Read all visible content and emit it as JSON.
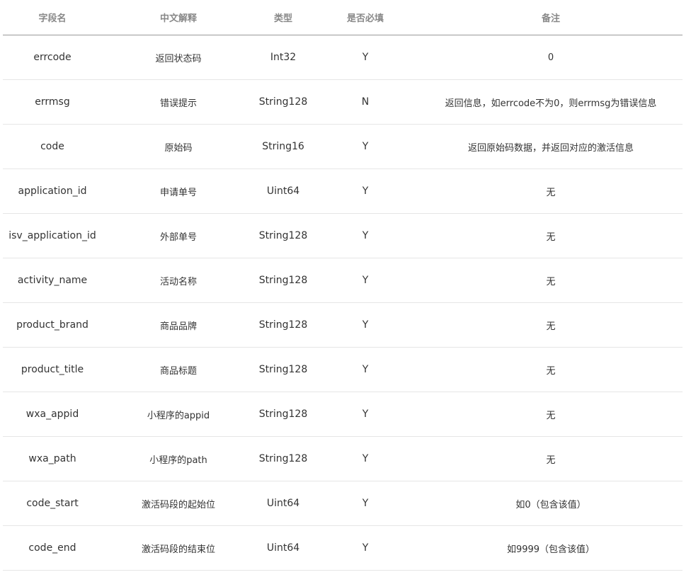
{
  "table": {
    "headers": [
      "字段名",
      "中文解释",
      "类型",
      "是否必填",
      "备注"
    ],
    "rows": [
      [
        "errcode",
        "返回状态码",
        "Int32",
        "Y",
        "0"
      ],
      [
        "errmsg",
        "错误提示",
        "String128",
        "N",
        "返回信息，如errcode不为0，则errmsg为错误信息"
      ],
      [
        "code",
        "原始码",
        "String16",
        "Y",
        "返回原始码数据，并返回对应的激活信息"
      ],
      [
        "application_id",
        "申请单号",
        "Uint64",
        "Y",
        "无"
      ],
      [
        "isv_application_id",
        "外部单号",
        "String128",
        "Y",
        "无"
      ],
      [
        "activity_name",
        "活动名称",
        "String128",
        "Y",
        "无"
      ],
      [
        "product_brand",
        "商品品牌",
        "String128",
        "Y",
        "无"
      ],
      [
        "product_title",
        "商品标题",
        "String128",
        "Y",
        "无"
      ],
      [
        "wxa_appid",
        "小程序的appid",
        "String128",
        "Y",
        "无"
      ],
      [
        "wxa_path",
        "小程序的path",
        "String128",
        "Y",
        "无"
      ],
      [
        "code_start",
        "激活码段的起始位",
        "Uint64",
        "Y",
        "如0（包含该值）"
      ],
      [
        "code_end",
        "激活码段的结束位",
        "Uint64",
        "Y",
        "如9999（包含该值）"
      ]
    ]
  }
}
